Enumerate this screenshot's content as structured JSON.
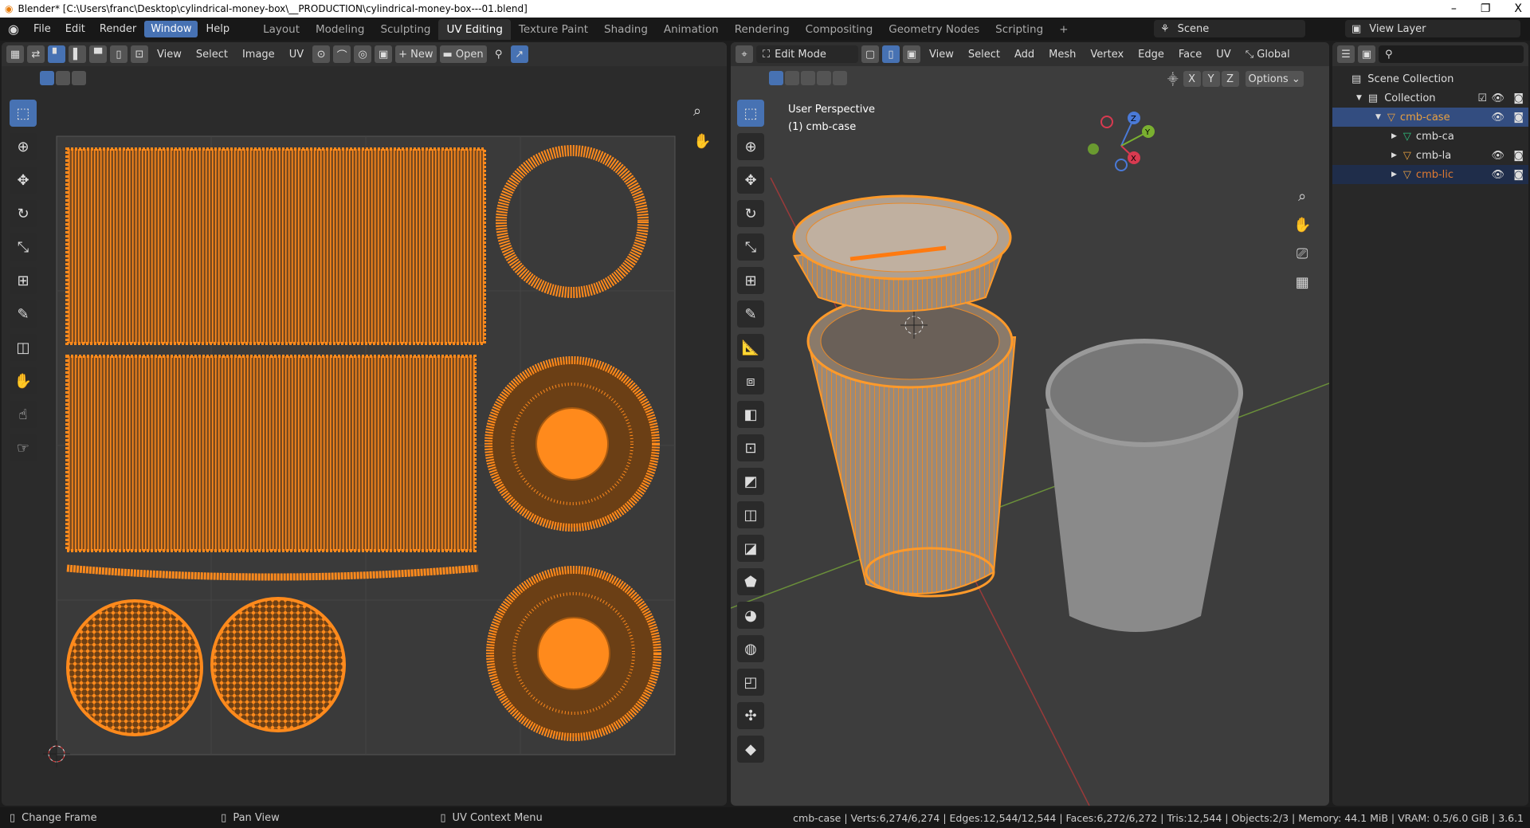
{
  "window": {
    "title": "Blender* [C:\\Users\\franc\\Desktop\\cylindrical-money-box\\__PRODUCTION\\cylindrical-money-box---01.blend]",
    "minimize": "–",
    "maximize": "❐",
    "close": "X"
  },
  "menus": [
    "File",
    "Edit",
    "Render",
    "Window",
    "Help"
  ],
  "workspaces": [
    "Layout",
    "Modeling",
    "Sculpting",
    "UV Editing",
    "Texture Paint",
    "Shading",
    "Animation",
    "Rendering",
    "Compositing",
    "Geometry Nodes",
    "Scripting",
    "+"
  ],
  "active_workspace": "UV Editing",
  "scene": {
    "label": "Scene",
    "view_layer": "View Layer"
  },
  "uv_editor": {
    "menus": [
      "View",
      "Select",
      "Image",
      "UV"
    ],
    "new_label": "New",
    "open_label": "Open"
  },
  "viewport": {
    "mode": "Edit Mode",
    "menus": [
      "View",
      "Select",
      "Add",
      "Mesh",
      "Vertex",
      "Edge",
      "Face",
      "UV"
    ],
    "orientation": "Global",
    "axes": [
      "X",
      "Y",
      "Z"
    ],
    "options": "Options",
    "overlay_title": "User Perspective",
    "overlay_object": "(1) cmb-case"
  },
  "outliner": {
    "scene_collection": "Scene Collection",
    "collection": "Collection",
    "items": [
      {
        "name": "cmb-case",
        "color": "#e8a040"
      },
      {
        "name": "cmb-ca",
        "color": "#dddddd"
      },
      {
        "name": "cmb-la",
        "color": "#dddddd"
      },
      {
        "name": "cmb-lic",
        "color": "#e07a30"
      }
    ]
  },
  "status": {
    "hints": [
      "Change Frame",
      "Pan View",
      "UV Context Menu"
    ],
    "stats": "cmb-case | Verts:6,274/6,274 | Edges:12,544/12,544 | Faces:6,272/6,272 | Tris:12,544 | Objects:2/3 | Memory: 44.1 MiB | VRAM: 0.5/6.0 GiB | 3.6.1"
  },
  "colors": {
    "accent": "#4772b3",
    "uv": "#ff8a1c",
    "select": "#e87d0d"
  }
}
